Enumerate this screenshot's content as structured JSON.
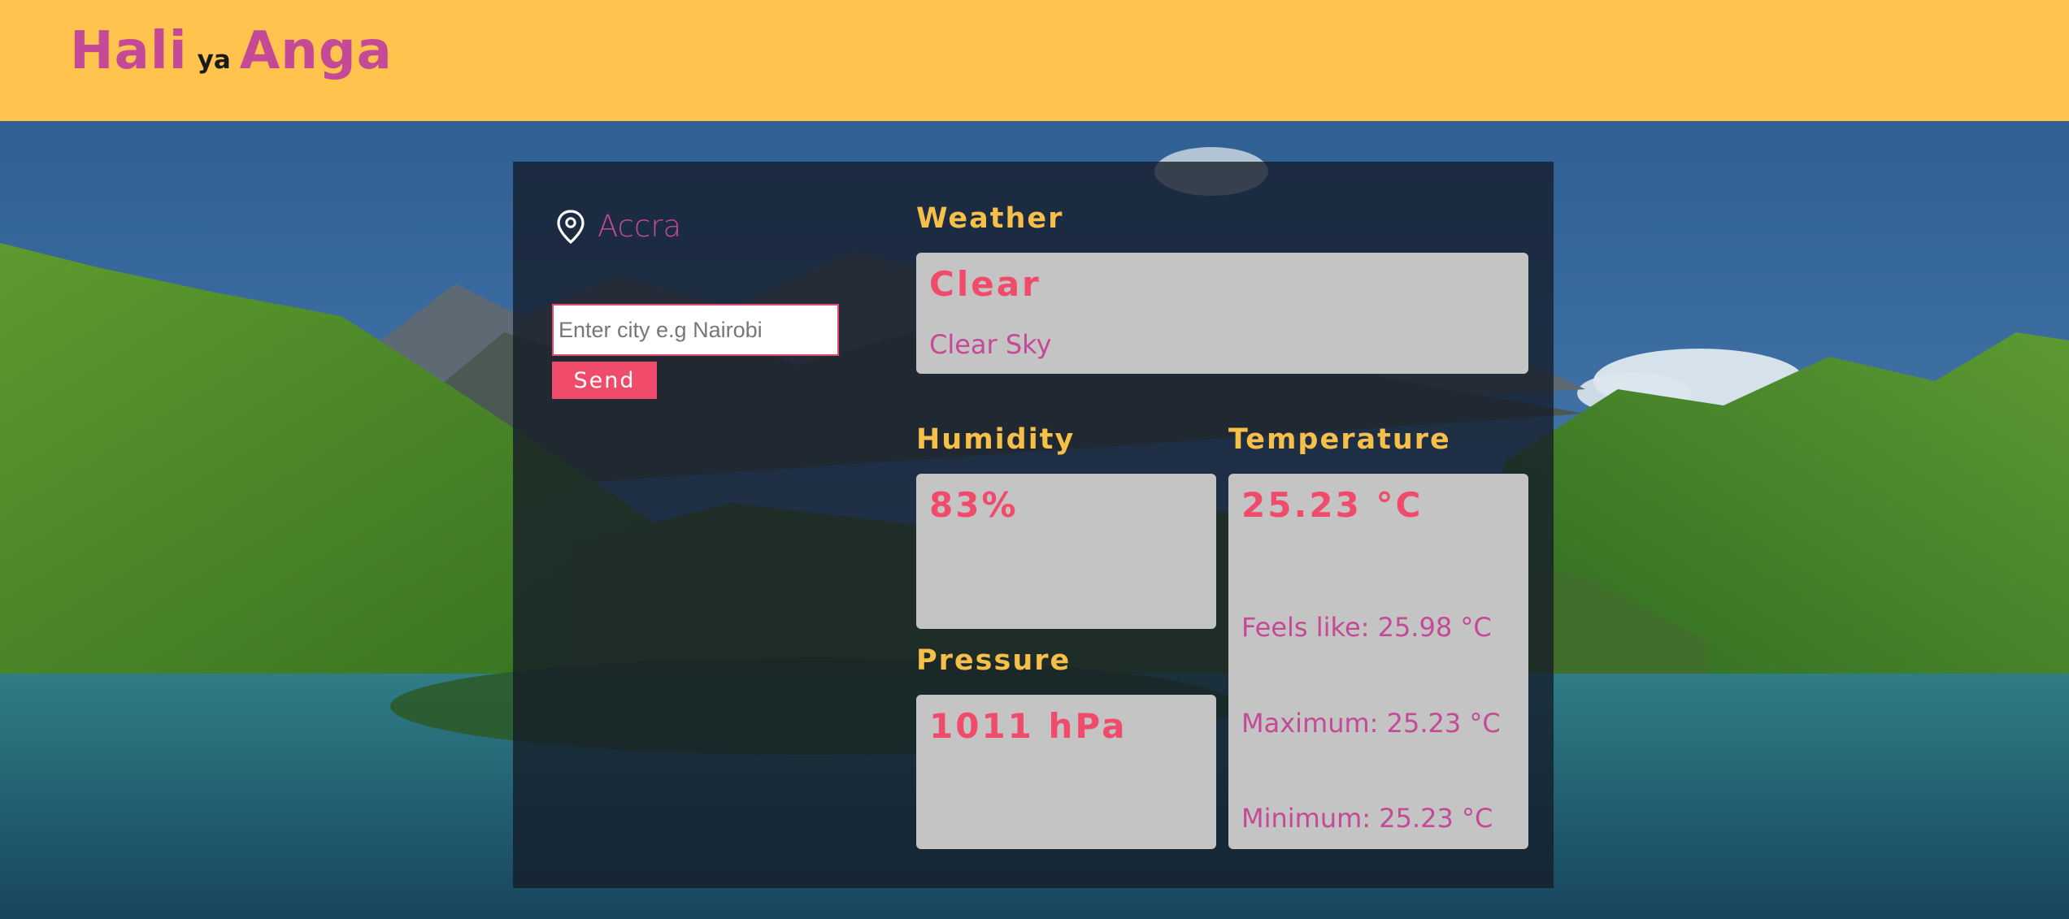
{
  "brand": {
    "part1": "Hali",
    "part2": "ya",
    "part3": "Anga"
  },
  "colors": {
    "header_bg": "#ffc34e",
    "brand_pink": "#c44a97",
    "accent_red": "#f04b6a",
    "section_title": "#f6bf49",
    "card_bg": "#c4c4c4",
    "panel_bg": "#141b28"
  },
  "location": {
    "icon": "map-pin-icon",
    "city": "Accra"
  },
  "search": {
    "placeholder": "Enter city e.g Nairobi",
    "value": ""
  },
  "send_label": "Send",
  "weather": {
    "title": "Weather",
    "main": "Clear",
    "description": "Clear Sky"
  },
  "humidity": {
    "title": "Humidity",
    "value": "83%"
  },
  "pressure": {
    "title": "Pressure",
    "value": "1011 hPa"
  },
  "temperature": {
    "title": "Temperature",
    "value": "25.23 °C",
    "feels_like": "Feels like: 25.98 °C",
    "maximum": "Maximum: 25.23 °C",
    "minimum": "Minimum: 25.23 °C"
  }
}
